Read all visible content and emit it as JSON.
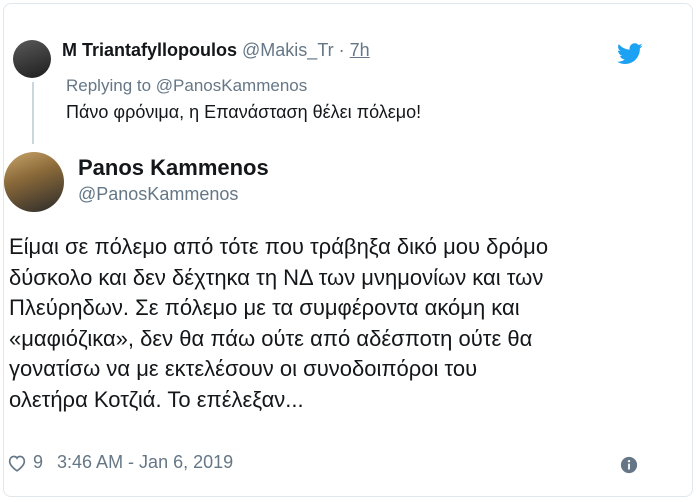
{
  "reply": {
    "name": "M Triantafyllopoulos",
    "handle": "@Makis_Tr",
    "dot": "·",
    "time": "7h",
    "replying_prefix": "Replying to",
    "replying_mention": "@PanosKammenos",
    "text": "Πάνο φρόνιμα, η Επανάσταση θέλει πόλεμο!"
  },
  "tweet": {
    "name": "Panos Kammenos",
    "handle": "@PanosKammenos",
    "lines": [
      "Είμαι σε πόλεμο από τότε που τράβηξα δικό μου δρόμο",
      "δύσκολο και δεν δέχτηκα τη ΝΔ των μνημονίων και των",
      "Πλεύρηδων. Σε πόλεμο με τα συμφέροντα ακόμη και",
      "«μαφιόζικα», δεν θα πάω ούτε από αδέσποτη ούτε θα",
      "γονατίσω να με εκτελέσουν οι συνοδοιπόροι του",
      "ολετήρα Κοτζιά. Το επέλεξαν..."
    ],
    "like_count": "9",
    "timestamp": "3:46 AM - Jan 6, 2019"
  },
  "icons": {
    "bird": "twitter-bird-icon",
    "heart": "heart-icon",
    "info": "info-icon"
  },
  "colors": {
    "brand_blue": "#1da1f2",
    "secondary_text": "#657786",
    "primary_text": "#14171a"
  }
}
